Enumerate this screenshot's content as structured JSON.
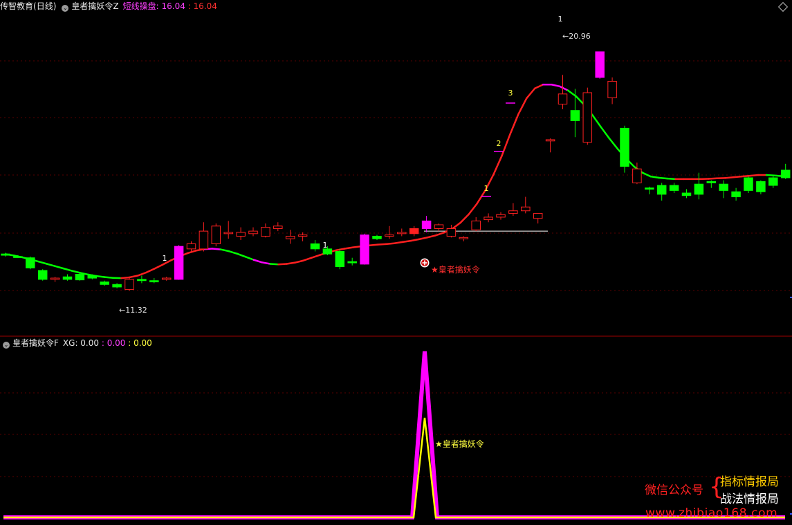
{
  "header": {
    "title": "传智教育",
    "period": "(日线)",
    "indicator_main": "皇者擒妖令Z",
    "line_label": "短线操盘",
    "value_a": "16.04",
    "value_b": "16.04"
  },
  "sub_header": {
    "indicator": "皇者擒妖令F",
    "xg_label": "XG",
    "xg_value": "0.00",
    "value_b": "0.00",
    "value_c": "0.00"
  },
  "colors": {
    "background": "#000000",
    "up": "#ff2020",
    "down": "#00ff00",
    "signal": "#ff00ff",
    "sub_yellow": "#ffff00",
    "grid": "#5a0000",
    "divider": "#a00000"
  },
  "chart_data": [
    {
      "type": "candlestick",
      "title": "皇者擒妖令Z",
      "ylim": [
        10.2,
        22.4
      ],
      "grid": true,
      "ohlc": [
        [
          13.0,
          13.05,
          12.9,
          12.95
        ],
        [
          12.9,
          12.95,
          12.85,
          12.88
        ],
        [
          12.85,
          12.9,
          12.4,
          12.45
        ],
        [
          12.35,
          12.4,
          11.95,
          12.0
        ],
        [
          12.0,
          12.1,
          11.9,
          12.05
        ],
        [
          12.1,
          12.2,
          11.95,
          12.0
        ],
        [
          12.2,
          12.25,
          11.95,
          11.98
        ],
        [
          12.15,
          12.2,
          12.0,
          12.05
        ],
        [
          11.9,
          11.95,
          11.75,
          11.8
        ],
        [
          11.8,
          11.85,
          11.65,
          11.7
        ],
        [
          11.6,
          12.05,
          11.55,
          12.0
        ],
        [
          12.0,
          12.15,
          11.85,
          11.95
        ],
        [
          11.95,
          12.05,
          11.85,
          11.9
        ],
        [
          12.0,
          12.1,
          11.95,
          12.05
        ],
        [
          12.0,
          13.35,
          11.98,
          13.3
        ],
        [
          13.2,
          13.5,
          13.1,
          13.4
        ],
        [
          13.2,
          14.25,
          13.1,
          13.9
        ],
        [
          13.4,
          14.2,
          13.3,
          14.1
        ],
        [
          13.8,
          14.3,
          13.6,
          13.85
        ],
        [
          13.7,
          14.05,
          13.55,
          13.85
        ],
        [
          13.8,
          14.05,
          13.7,
          13.9
        ],
        [
          13.7,
          14.2,
          13.65,
          14.05
        ],
        [
          14.0,
          14.25,
          13.9,
          14.1
        ],
        [
          13.6,
          13.95,
          13.4,
          13.7
        ],
        [
          13.7,
          13.85,
          13.5,
          13.75
        ],
        [
          13.4,
          13.55,
          13.1,
          13.2
        ],
        [
          13.2,
          13.3,
          12.95,
          13.0
        ],
        [
          13.1,
          13.2,
          12.4,
          12.5
        ],
        [
          12.7,
          12.85,
          12.55,
          12.65
        ],
        [
          12.6,
          13.8,
          12.58,
          13.75
        ],
        [
          13.7,
          13.75,
          13.55,
          13.6
        ],
        [
          13.7,
          14.1,
          13.6,
          13.75
        ],
        [
          13.8,
          14.0,
          13.7,
          13.85
        ],
        [
          13.8,
          14.1,
          13.7,
          14.0
        ],
        [
          14.0,
          14.5,
          13.85,
          14.3
        ],
        [
          14.0,
          14.2,
          13.9,
          14.15
        ],
        [
          13.7,
          14.15,
          13.65,
          14.0
        ],
        [
          13.6,
          13.7,
          13.5,
          13.65
        ],
        [
          13.95,
          14.45,
          13.9,
          14.3
        ],
        [
          14.35,
          14.6,
          14.25,
          14.45
        ],
        [
          14.45,
          14.65,
          14.35,
          14.55
        ],
        [
          14.6,
          15.0,
          14.5,
          14.7
        ],
        [
          14.7,
          15.25,
          14.6,
          14.85
        ],
        [
          14.4,
          14.6,
          14.2,
          14.6
        ],
        [
          17.45,
          17.55,
          17.0,
          17.5
        ],
        [
          18.9,
          20.05,
          18.7,
          19.3
        ],
        [
          18.65,
          19.5,
          17.6,
          18.25
        ],
        [
          17.4,
          19.55,
          17.3,
          19.35
        ],
        [
          19.95,
          20.96,
          19.9,
          20.96
        ],
        [
          19.15,
          19.95,
          18.9,
          19.8
        ],
        [
          17.95,
          18.05,
          16.2,
          16.45
        ],
        [
          15.8,
          16.6,
          15.75,
          16.35
        ],
        [
          15.6,
          15.65,
          15.35,
          15.55
        ],
        [
          15.7,
          15.8,
          15.1,
          15.35
        ],
        [
          15.7,
          15.8,
          15.4,
          15.5
        ],
        [
          15.4,
          15.55,
          15.2,
          15.3
        ],
        [
          15.75,
          16.2,
          15.15,
          15.35
        ],
        [
          15.85,
          15.9,
          15.6,
          15.8
        ],
        [
          15.75,
          15.9,
          15.2,
          15.5
        ],
        [
          15.45,
          15.6,
          15.1,
          15.25
        ],
        [
          16.0,
          16.05,
          15.4,
          15.5
        ],
        [
          15.85,
          15.9,
          15.35,
          15.45
        ],
        [
          16.0,
          16.1,
          15.6,
          15.7
        ],
        [
          16.3,
          16.55,
          15.95,
          16.0
        ],
        [
          16.05,
          16.35,
          15.75,
          15.85
        ],
        [
          15.85,
          15.9,
          15.45,
          15.55
        ],
        [
          15.8,
          15.85,
          15.55,
          15.6
        ]
      ],
      "ma_line": [
        12.99,
        12.94,
        12.87,
        12.79,
        12.7,
        12.61,
        12.52,
        12.43,
        12.34,
        12.26,
        12.19,
        12.13,
        12.09,
        12.06,
        12.05,
        12.08,
        12.15,
        12.27,
        12.42,
        12.58,
        12.75,
        12.9,
        13.03,
        13.13,
        13.19,
        13.21,
        13.18,
        13.11,
        13.01,
        12.89,
        12.77,
        12.67,
        12.61,
        12.59,
        12.61,
        12.66,
        12.74,
        12.85,
        12.96,
        13.06,
        13.15,
        13.21,
        13.26,
        13.3,
        13.34,
        13.37,
        13.39,
        13.42,
        13.47,
        13.52,
        13.58,
        13.65,
        13.73,
        13.84,
        13.99,
        14.23,
        14.56,
        14.98,
        15.5,
        16.13,
        16.86,
        17.71,
        18.5,
        19.13,
        19.52,
        19.67,
        19.67,
        19.6,
        19.44,
        19.2,
        18.86,
        18.45,
        17.99,
        17.55,
        17.14,
        16.77,
        16.44,
        16.2,
        16.05,
        16.0,
        15.97,
        15.95,
        15.95,
        15.95,
        15.95,
        15.96,
        15.98,
        15.99,
        16.02,
        16.05,
        16.08,
        16.11,
        16.11,
        16.09,
        16.06
      ],
      "signal_markers": [
        {
          "label": "1"
        },
        {
          "label": "1"
        },
        {
          "label": "1"
        },
        {
          "label": "2"
        },
        {
          "label": "3"
        },
        {
          "label": "1"
        }
      ],
      "annotations": {
        "low_label": "11.32",
        "high_label": "20.96",
        "signal_name": "★皇者擒妖令",
        "support_level": 13.9
      }
    },
    {
      "type": "line",
      "title": "皇者擒妖令F",
      "ylim": [
        0,
        100
      ],
      "series": [
        {
          "name": "XG",
          "values_note": "spike",
          "spike_bar": 44,
          "spike_value": 100
        },
        {
          "name": "",
          "spike_bar": 44,
          "spike_value": 60
        }
      ],
      "annotation": "★皇者擒妖令"
    }
  ],
  "watermark": {
    "left": "微信公众号",
    "right_top": "指标情报局",
    "right_bottom": "战法情报局",
    "url": "www.zhibiao168.com"
  }
}
